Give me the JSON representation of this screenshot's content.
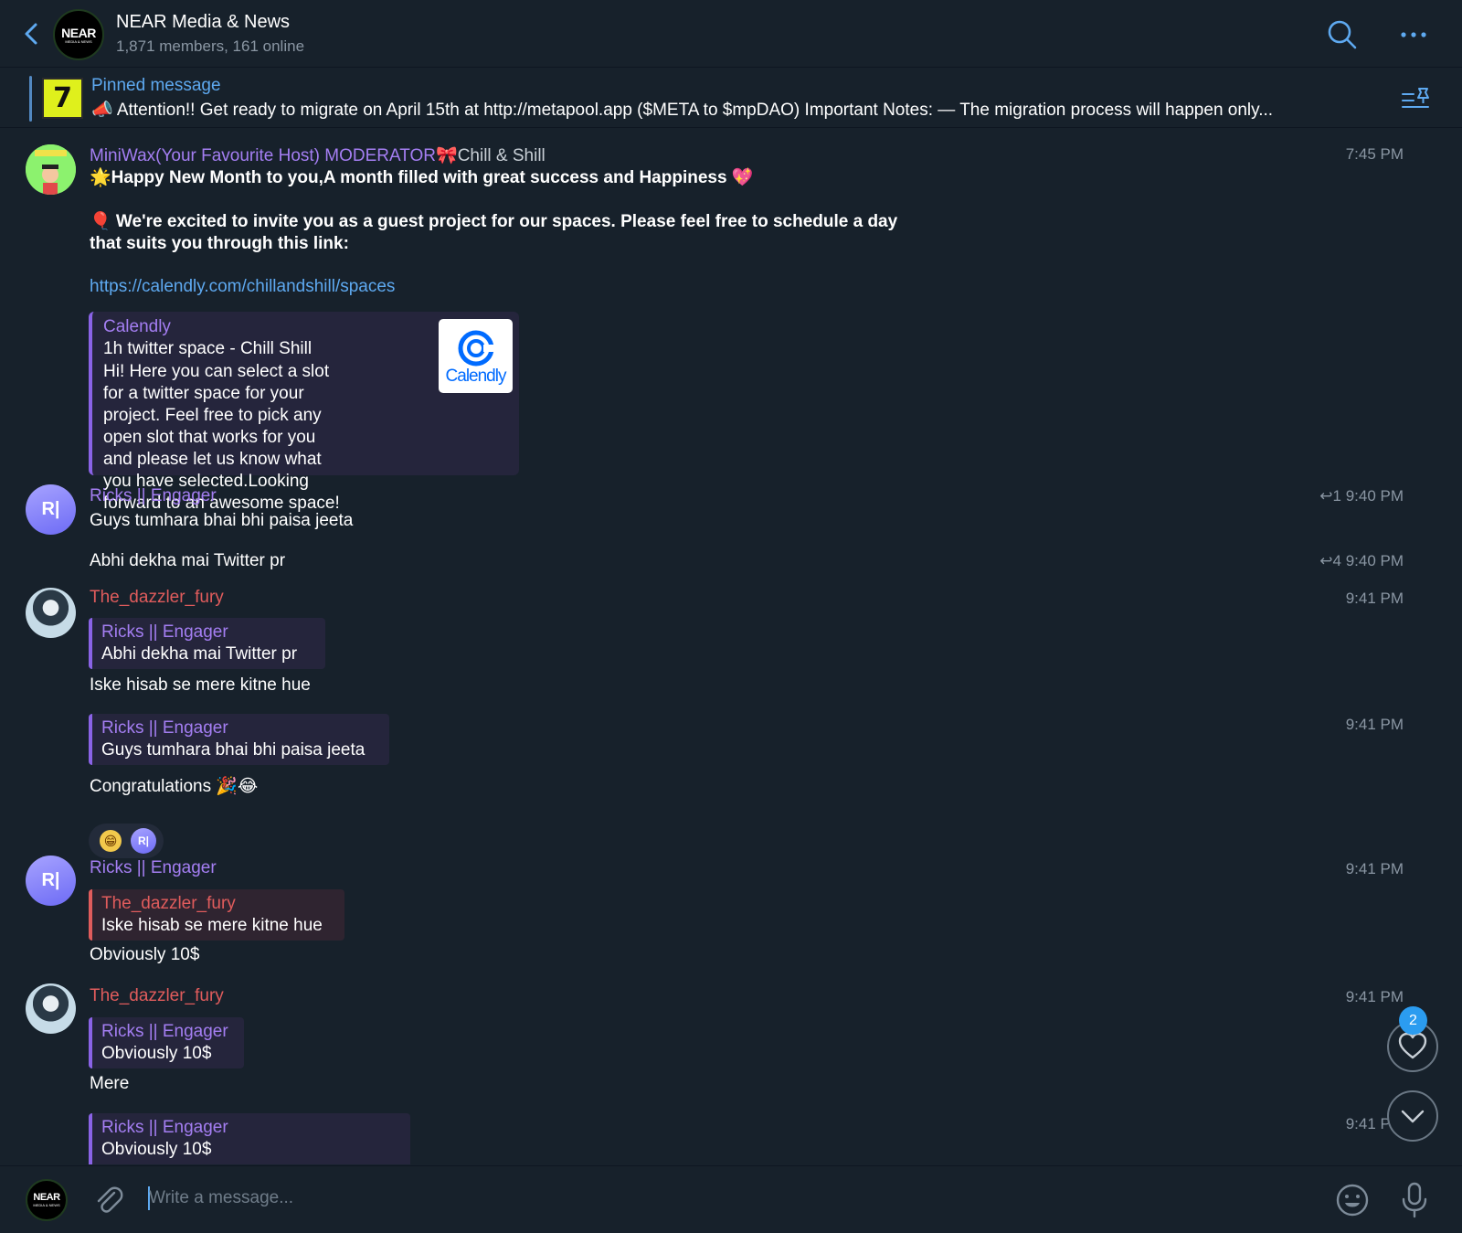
{
  "header": {
    "title": "NEAR Media & News",
    "subtitle": "1,871 members, 161 online",
    "logo_main": "NEAR",
    "logo_sub": "MEDIA & NEWS"
  },
  "pinned": {
    "label": "Pinned message",
    "thumb_text": "7",
    "text": "📣 Attention!!  Get ready to migrate on April 15th at  http://metapool.app ($META to $mpDAO)  Important Notes: — The migration process will happen only..."
  },
  "messages": {
    "m1": {
      "sender": "MiniWax(Your Favourite Host) MODERATOR",
      "sender_tag": "🎀Chill & Shill",
      "time": "7:45 PM",
      "line1": "🌟Happy New Month to you,A month filled with great success and Happiness 💖",
      "line2": "🎈  We're excited to invite you as a guest project for our spaces. Please feel free to schedule a day",
      "line3": "that suits you through this link:",
      "link": "https://calendly.com/chillandshill/spaces",
      "preview": {
        "site": "Calendly",
        "title": "1h twitter space - Chill Shill",
        "desc": "Hi! Here you can select a slot for a twitter space for your project. Feel free to pick any open slot that works for you and please let us know what you have selected.Looking forward to an awesome space!",
        "logo_text": "Calendly"
      }
    },
    "m2": {
      "sender": "Ricks || Engager",
      "avatar": "R|",
      "text": "Guys tumhara bhai bhi paisa jeeta",
      "time": "↩1 9:40 PM"
    },
    "m3": {
      "text": "Abhi dekha mai Twitter pr",
      "time": "↩4 9:40 PM"
    },
    "m4": {
      "sender": "The_dazzler_fury",
      "time": "9:41 PM",
      "quote_name": "Ricks || Engager",
      "quote_text": "Abhi dekha mai Twitter pr",
      "text": "Iske hisab se mere kitne hue"
    },
    "m5": {
      "time": "9:41 PM",
      "quote_name": "Ricks || Engager",
      "quote_text": "Guys tumhara bhai bhi paisa jeeta",
      "text": "Congratulations 🎉😂",
      "reaction_emoji": "😁",
      "reaction_avatar": "R|"
    },
    "m6": {
      "sender": "Ricks || Engager",
      "avatar": "R|",
      "time": "9:41 PM",
      "quote_name": "The_dazzler_fury",
      "quote_text": "Iske hisab se mere kitne hue",
      "text": "Obviously 10$"
    },
    "m7": {
      "sender": "The_dazzler_fury",
      "time": "9:41 PM",
      "quote_name": "Ricks || Engager",
      "quote_text": "Obviously 10$",
      "text": "Mere"
    },
    "m8": {
      "time": "9:41 PM",
      "quote_name": "Ricks || Engager",
      "quote_text": "Obviously 10$"
    }
  },
  "floating": {
    "reactions_badge": "2"
  },
  "composer": {
    "placeholder": "Write a message..."
  },
  "colors": {
    "background": "#17212b",
    "accent": "#5ea9f0",
    "purple_name": "#a47ef2",
    "red_name": "#e05c5c"
  },
  "icons": [
    "back-icon",
    "search-icon",
    "more-icon",
    "pinned-list-icon",
    "heart-icon",
    "chevron-down-icon",
    "attach-icon",
    "emoji-icon",
    "microphone-icon"
  ]
}
